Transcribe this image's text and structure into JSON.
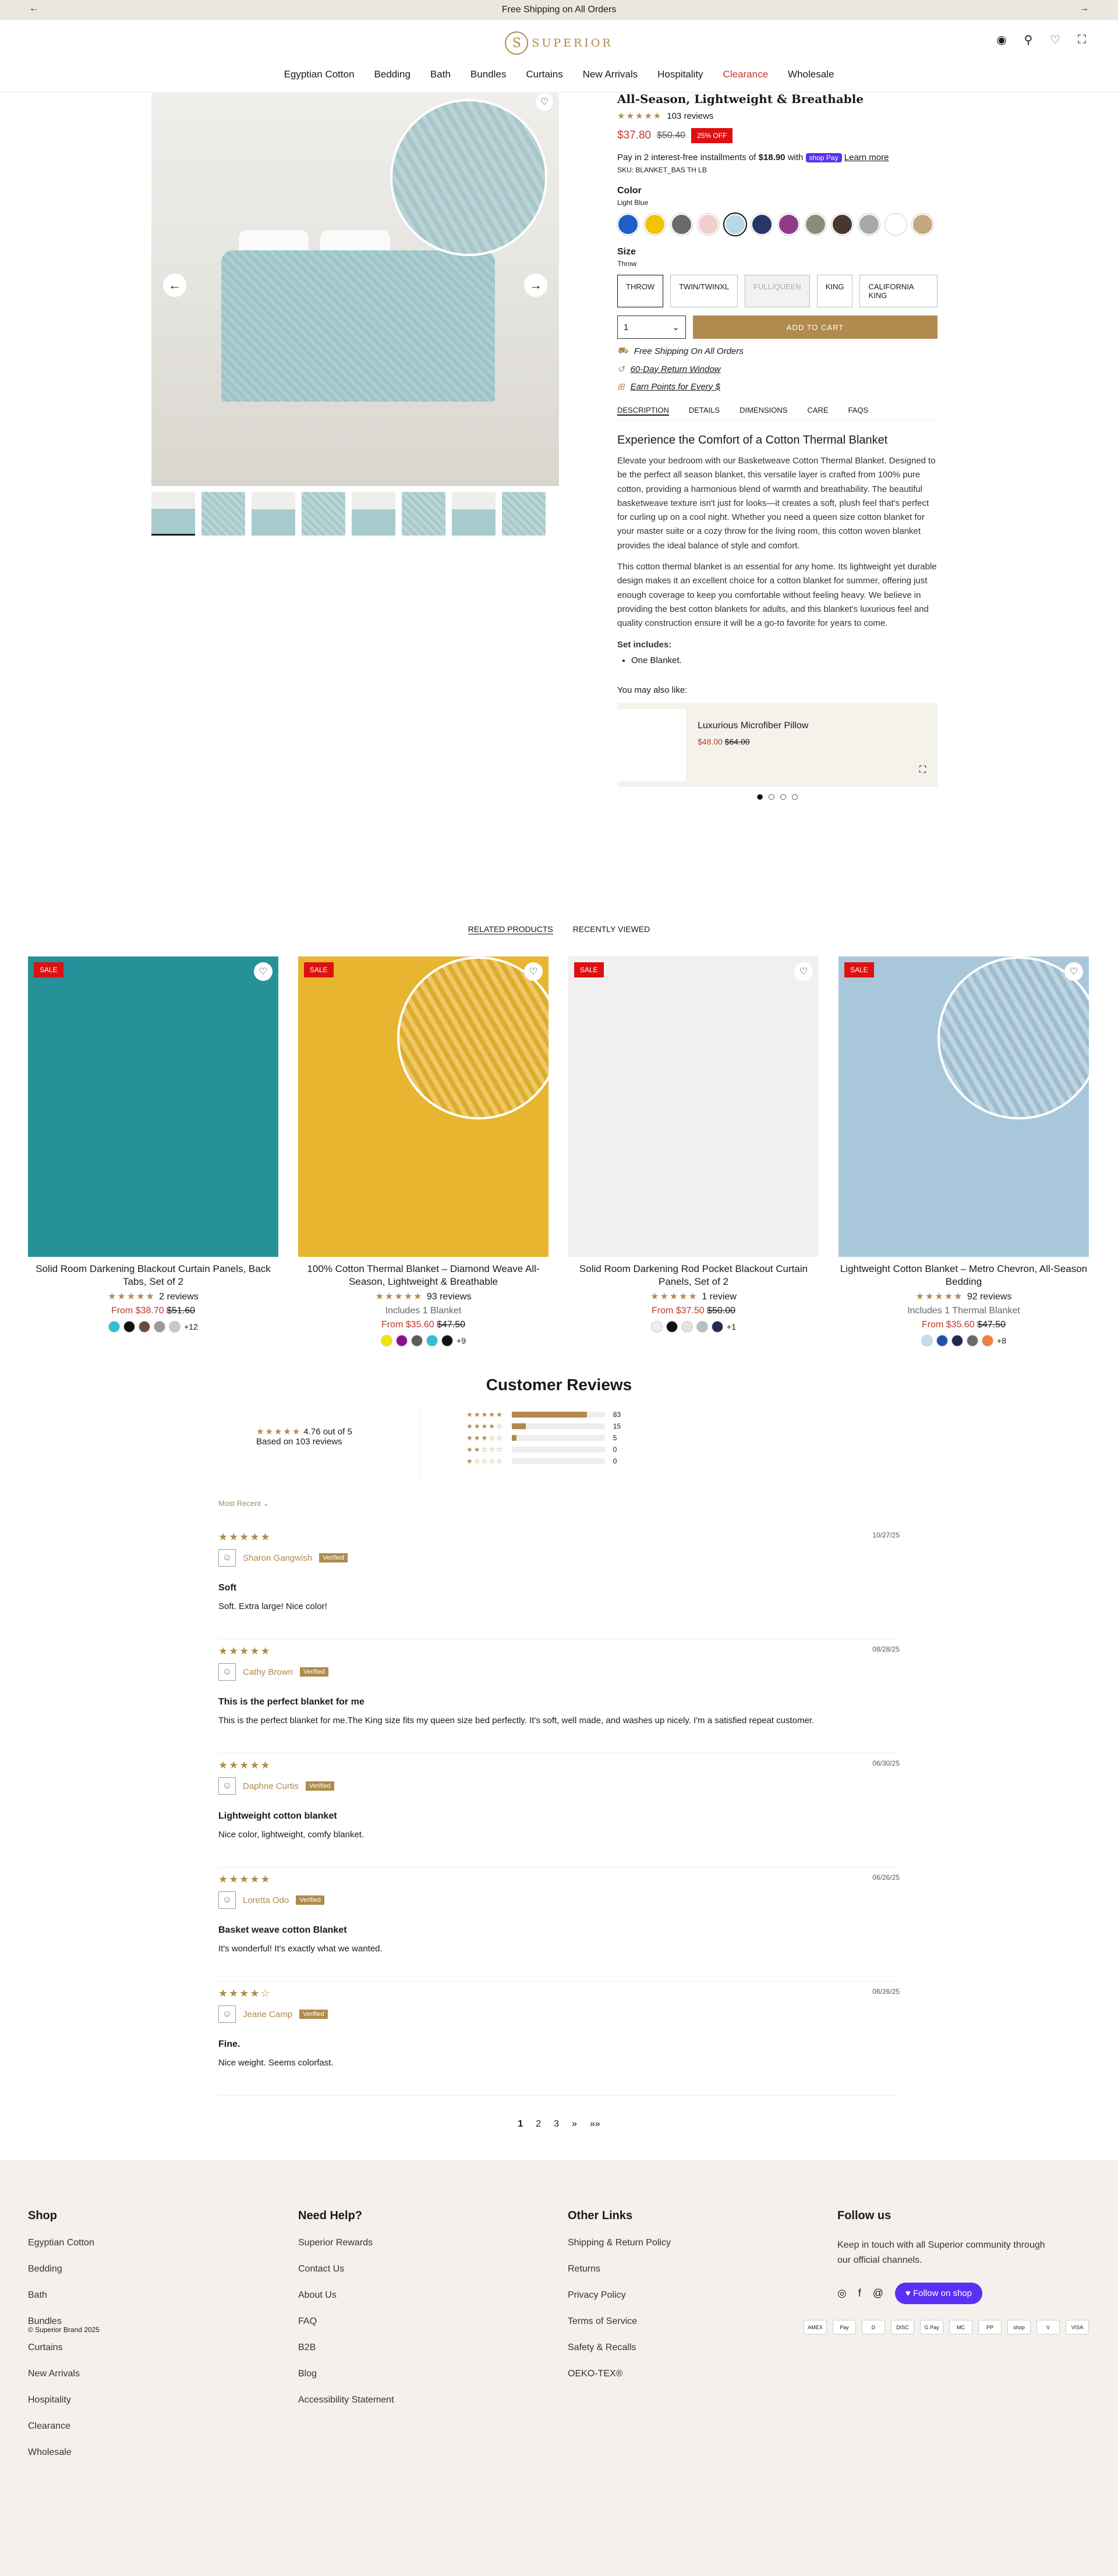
{
  "announcement": {
    "text": "Free Shipping on All Orders"
  },
  "brand": {
    "name": "SUPERIOR",
    "accent": "#b08a4e"
  },
  "nav": [
    "Egyptian Cotton",
    "Bedding",
    "Bath",
    "Bundles",
    "Curtains",
    "New Arrivals",
    "Hospitality",
    "Clearance",
    "Wholesale"
  ],
  "product": {
    "title": "All-Season, Lightweight & Breathable",
    "review_count": "103 reviews",
    "price": "$37.80",
    "compare_price": "$50.40",
    "discount": "25% OFF",
    "installments": "Pay in 2 interest-free installments of",
    "installment_amount": "$18.90",
    "installments_with": "with",
    "shop_pay": "shop Pay",
    "learn_more": "Learn more",
    "sku": "SKU: BLANKET_BAS TH LB",
    "color_label": "Color",
    "color_value": "Light Blue",
    "colors": [
      "#1f5fc9",
      "#f2c300",
      "#6a6a6a",
      "#f1cfc8",
      "#b8d8e6",
      "#263766",
      "#8e3b8a",
      "#8f8a7e",
      "#4b362c",
      "#a9a9a9",
      "#ffffff",
      "#c4a77f"
    ],
    "size_label": "Size",
    "size_value": "Throw",
    "sizes": [
      "THROW",
      "TWIN/TWINXL",
      "FULL/QUEEN",
      "KING",
      "CALIFORNIA KING"
    ],
    "qty": "1",
    "add_to_cart": "ADD TO CART",
    "perks": [
      "Free Shipping On All Orders",
      "60-Day Return Window",
      "Earn Points for Every $"
    ],
    "tabs": [
      "DESCRIPTION",
      "DETAILS",
      "DIMENSIONS",
      "CARE",
      "FAQS"
    ],
    "desc_heading": "Experience the Comfort of a Cotton Thermal Blanket",
    "desc_p1": "Elevate your bedroom with our Basketweave Cotton Thermal Blanket. Designed to be the perfect all season blanket, this versatile layer is crafted from 100% pure cotton, providing a harmonious blend of warmth and breathability. The beautiful basketweave texture isn't just for looks—it creates a soft, plush feel that's perfect for curling up on a cool night. Whether you need a queen size cotton blanket for your master suite or a cozy throw for the living room, this cotton woven blanket provides the ideal balance of style and comfort.",
    "desc_p2": "This cotton thermal blanket is an essential for any home. Its lightweight yet durable design makes it an excellent choice for a cotton blanket for summer, offering just enough coverage to keep you comfortable without feeling heavy. We believe in providing the best cotton blankets for adults, and this blanket's luxurious feel and quality construction ensure it will be a go-to favorite for years to come.",
    "set_label": "Set includes:",
    "set_items": [
      "One Blanket."
    ],
    "ymal_label": "You may also like:",
    "ymal_name": "Luxurious Microfiber Pillow",
    "ymal_price": "$48.00",
    "ymal_was": "$64.00"
  },
  "related_tabs": [
    "RELATED PRODUCTS",
    "RECENTLY VIEWED"
  ],
  "related": [
    {
      "name": "Solid Room Darkening Blackout Curtain Panels, Back Tabs, Set of 2",
      "reviews": "2 reviews",
      "inc": "",
      "price": "From $38.70",
      "was": "$51.60",
      "more": "+12",
      "sale": "SALE",
      "colors": [
        "#2fc0d6",
        "#111111",
        "#6b4a3a",
        "#9a9a9a",
        "#c9c9c9"
      ],
      "img": "#27919a"
    },
    {
      "name": "100% Cotton Thermal Blanket – Diamond Weave All-Season, Lightweight & Breathable",
      "reviews": "93 reviews",
      "inc": "Includes 1 Blanket",
      "price": "From $35.60",
      "was": "$47.50",
      "more": "+9",
      "sale": "SALE",
      "colors": [
        "#f2e600",
        "#8b0f8e",
        "#5c5c5c",
        "#2fc0d6",
        "#111111"
      ],
      "img": "#e8b530"
    },
    {
      "name": "Solid Room Darkening Rod Pocket Blackout Curtain Panels, Set of 2",
      "reviews": "1 review",
      "inc": "",
      "price": "From $37.50",
      "was": "$50.00",
      "more": "+1",
      "sale": "SALE",
      "colors": [
        "#eeeeee",
        "#111111",
        "#e8e2d6",
        "#b9bdc8",
        "#1f2b52"
      ],
      "img": "#f0f0f0"
    },
    {
      "name": "Lightweight Cotton Blanket – Metro Chevron, All-Season Bedding",
      "reviews": "92 reviews",
      "inc": "Includes 1 Thermal Blanket",
      "price": "From $35.60",
      "was": "$47.50",
      "more": "+8",
      "sale": "SALE",
      "colors": [
        "#c6dbe8",
        "#2050a8",
        "#1f2b52",
        "#6a6a6a",
        "#f07f3c"
      ],
      "img": "#a8c7da"
    }
  ],
  "reviews_section": {
    "title": "Customer Reviews",
    "avg": "4.76 out of 5",
    "based": "Based on 103 reviews",
    "hist": [
      {
        "count": "83",
        "pct": 0.81
      },
      {
        "count": "15",
        "pct": 0.15
      },
      {
        "count": "5",
        "pct": 0.05
      },
      {
        "count": "0",
        "pct": 0
      },
      {
        "count": "0",
        "pct": 0
      }
    ],
    "sort": "Most Recent",
    "verified": "Verified",
    "items": [
      {
        "date": "10/27/25",
        "stars": "★★★★★",
        "name": "Sharon Gangwish",
        "title": "Soft",
        "body": "Soft. Extra large! Nice color!"
      },
      {
        "date": "08/28/25",
        "stars": "★★★★★",
        "name": "Cathy Brown",
        "title": "This is the perfect blanket for me",
        "body": "This is the perfect blanket for me.The King size fits my queen size bed perfectly. It's soft, well made, and washes up nicely. I'm a satisfied repeat customer."
      },
      {
        "date": "06/30/25",
        "stars": "★★★★★",
        "name": "Daphne Curtis",
        "title": "Lightweight cotton blanket",
        "body": "Nice color, lightweight, comfy blanket."
      },
      {
        "date": "06/26/25",
        "stars": "★★★★★",
        "name": "Loretta Odo",
        "title": "Basket weave cotton Blanket",
        "body": "It's wonderful! It's exactly what we wanted."
      },
      {
        "date": "06/26/25",
        "stars": "★★★★☆",
        "name": "Jeane Camp",
        "title": "Fine.",
        "body": "Nice weight. Seems colorfast."
      }
    ],
    "pages": [
      "1",
      "2",
      "3",
      "»",
      "»»"
    ]
  },
  "footer": {
    "shop_title": "Shop",
    "shop": [
      "Egyptian Cotton",
      "Bedding",
      "Bath",
      "Bundles",
      "Curtains",
      "New Arrivals",
      "Hospitality",
      "Clearance",
      "Wholesale"
    ],
    "help_title": "Need Help?",
    "help": [
      "Superior Rewards",
      "Contact Us",
      "About Us",
      "FAQ",
      "B2B",
      "Blog",
      "Accessibility Statement"
    ],
    "other_title": "Other Links",
    "other": [
      "Shipping & Return Policy",
      "Returns",
      "Privacy Policy",
      "Terms of Service",
      "Safety & Recalls",
      "OEKO-TEX®"
    ],
    "follow_title": "Follow us",
    "follow_text": "Keep in touch with all Superior community through our official channels.",
    "follow_btn": "Follow on shop",
    "copyright": "© Superior Brand 2025",
    "payments": [
      "AMEX",
      "Pay",
      "D",
      "DISC",
      "G Pay",
      "MC",
      "PP",
      "shop",
      "V",
      "VISA"
    ]
  }
}
